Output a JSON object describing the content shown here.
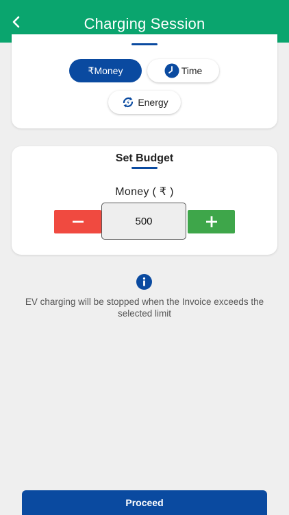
{
  "header": {
    "title": "Charging Session"
  },
  "mode_selector": {
    "money_label": "₹Money",
    "time_label": "Time",
    "energy_label": "Energy",
    "selected": "money"
  },
  "budget": {
    "title": "Set Budget",
    "money_label": "Money ( ₹ )",
    "amount": "500"
  },
  "info": {
    "message": "EV charging will be stopped when the Invoice exceeds the selected limit"
  },
  "footer": {
    "proceed_label": "Proceed"
  },
  "colors": {
    "header_bg": "#0aa56e",
    "primary": "#0a4aa0",
    "decrement": "#f04a40",
    "increment": "#3ea64a",
    "background": "#efefef"
  },
  "icons": {
    "back": "chevron-left-icon",
    "time": "clock-icon",
    "energy": "refresh-bolt-icon",
    "info": "info-icon",
    "minus": "minus-icon",
    "plus": "plus-icon"
  }
}
